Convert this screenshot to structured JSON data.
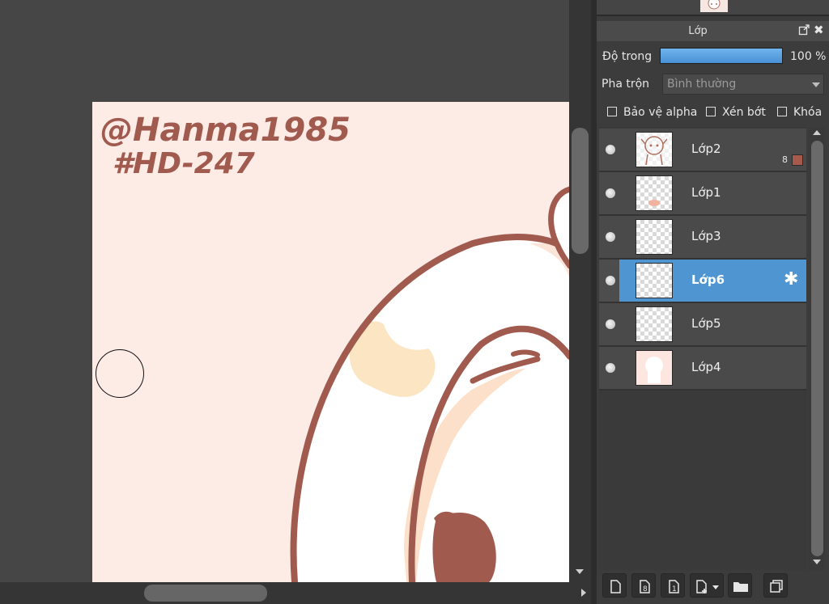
{
  "layer_panel": {
    "title": "Lớp",
    "opacity_label": "Độ trong",
    "opacity_value": "100 %",
    "opacity_fraction": 1.0,
    "blend_label": "Pha trộn",
    "blend_value": "Bình thường",
    "checkboxes": [
      {
        "label": "Bảo vệ alpha",
        "checked": false
      },
      {
        "label": "Xén bớt",
        "checked": false
      },
      {
        "label": "Khóa",
        "checked": false
      }
    ],
    "layers": [
      {
        "name": "Lớp2",
        "selected": false,
        "badge": "8",
        "badge_color": "#a65a4c"
      },
      {
        "name": "Lớp1",
        "selected": false
      },
      {
        "name": "Lớp3",
        "selected": false
      },
      {
        "name": "Lớp6",
        "selected": true
      },
      {
        "name": "Lớp5",
        "selected": false
      },
      {
        "name": "Lớp4",
        "selected": false
      }
    ],
    "toolbar_icons": [
      "new-layer-icon",
      "new-8bit-layer-icon",
      "new-1bit-layer-icon",
      "add-layer-menu-icon",
      "new-folder-icon",
      "duplicate-layer-icon"
    ]
  },
  "canvas": {
    "handwriting": [
      "@Hanma1985",
      "#HD-247"
    ]
  },
  "colors": {
    "selection": "#4f95d1",
    "outline": "#a05a4e",
    "canvas_bg": "#fdebe6",
    "highlight": "#f9dcc0"
  }
}
